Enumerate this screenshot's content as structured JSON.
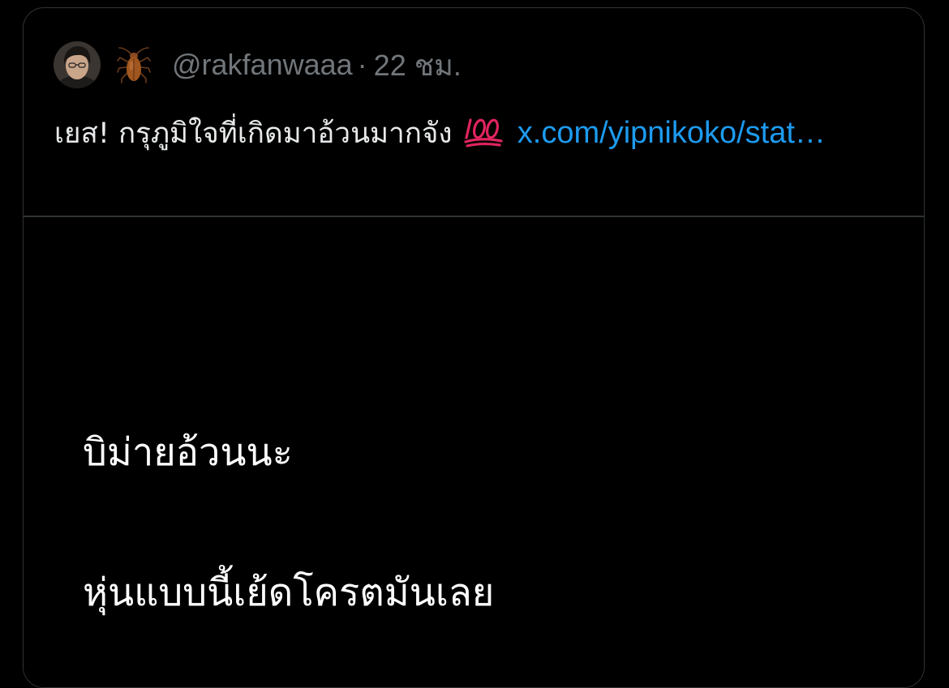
{
  "tweet": {
    "author_handle": "@rakfanwaaa",
    "separator": "·",
    "time_ago": "22 ชม.",
    "text": "เยส! กรุภูมิใจที่เกิดมาอ้วนมากจัง",
    "emoji": "💯",
    "link_text": "x.com/yipnikoko/stat…",
    "icons": {
      "avatar": "avatar-photo",
      "name_emoji": "cockroach-icon",
      "text_emoji": "hundred-points-icon"
    }
  },
  "media": {
    "line_1": "บิม่ายอ้วนนะ",
    "line_2": "หุ่นแบบนี้เย้ดโครตมันเลย"
  },
  "colors": {
    "background": "#000000",
    "border": "#2f3336",
    "secondary_text": "#71767b",
    "primary_text": "#e7e9ea",
    "link": "#1d9bf0",
    "emoji_red": "#e0245e"
  }
}
